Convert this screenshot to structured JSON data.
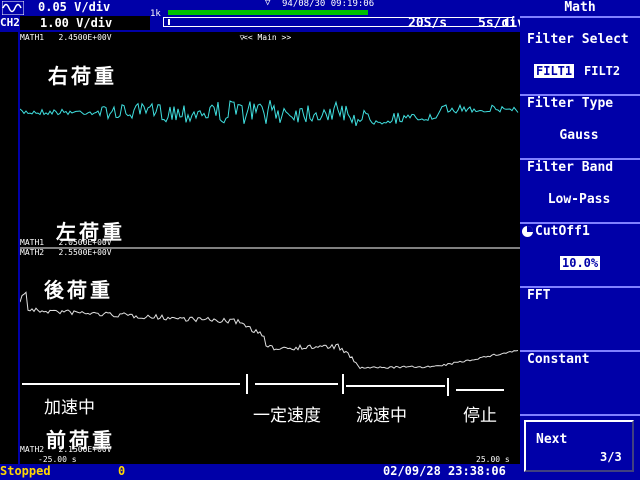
{
  "header": {
    "ch1_volts": "0.05 V/div",
    "ch2_label": "CH2",
    "ch2_volts": "1.00 V/div",
    "record_length": "1k",
    "trigger_datetime": "94/08/30 09:19:06",
    "sample_rate": "20S/s",
    "time_per_div": "5s/div"
  },
  "display": {
    "top_label": "MATH1   2.4500E+00V",
    "main_label": "<< Main >>",
    "math1_bottom": "MATH1   2.0500E+00V",
    "math2_top": "MATH2   2.5500E+00V",
    "math2_bottom": "MATH2   2.1500E+00V",
    "left_time": "-25.00 s",
    "right_time": "25.00 s",
    "label_right_load": "右荷重",
    "label_left_load": "左荷重",
    "label_rear_load": "後荷重",
    "label_front_load": "前荷重",
    "phase_accel": "加速中",
    "phase_constant": "一定速度",
    "phase_decel": "減速中",
    "phase_stop": "停止"
  },
  "menu": {
    "title": "Math",
    "filter_select_title": "Filter Select",
    "filt1": "FILT1",
    "filt2": "FILT2",
    "filter_type_title": "Filter Type",
    "filter_type_value": "Gauss",
    "filter_band_title": "Filter Band",
    "filter_band_value": "Low-Pass",
    "cutoff_title": "CutOff1",
    "cutoff_value": "10.0%",
    "fft_title": "FFT",
    "constant_title": "Constant",
    "next_label": "Next",
    "next_page": "3/3"
  },
  "status": {
    "state": "Stopped",
    "count": "0",
    "datetime": "02/09/28 23:38:06"
  },
  "colors": {
    "panel_blue": "#0000a8",
    "trace_cyan": "#40e0e0",
    "trace_white": "#e0e0e0",
    "status_yellow": "#ffd700"
  }
}
